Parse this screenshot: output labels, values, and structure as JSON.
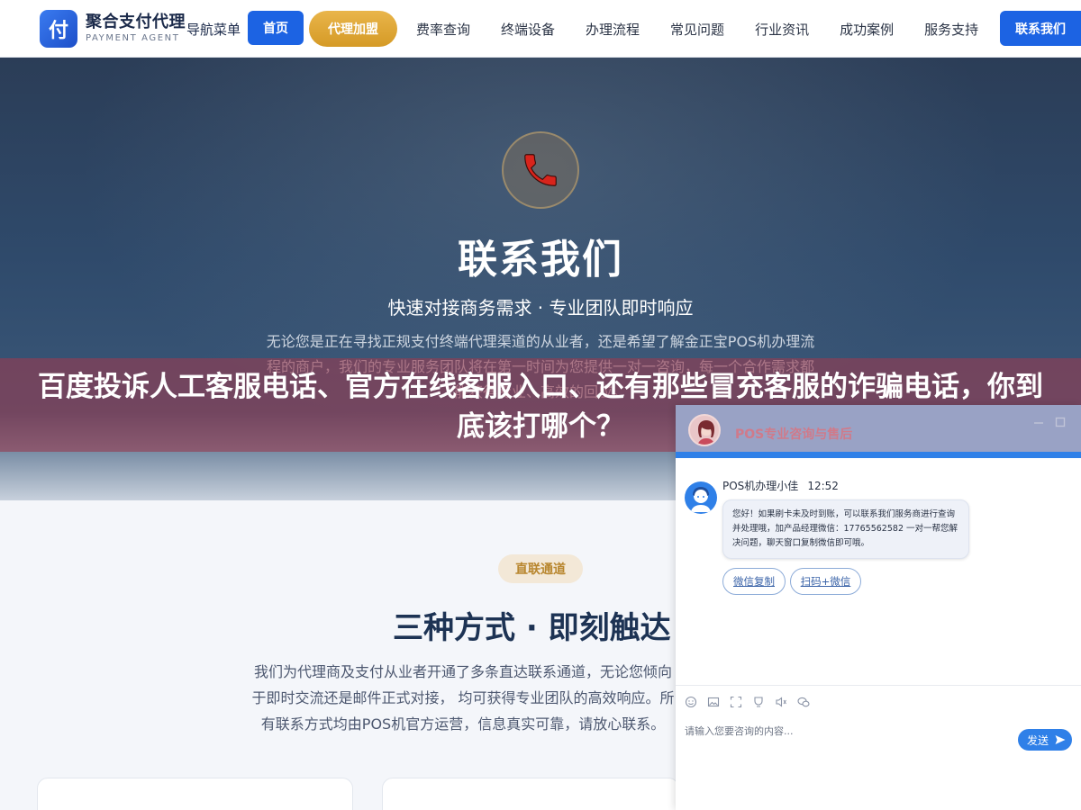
{
  "header": {
    "logo_mark": "付",
    "logo_cn": "聚合支付代理",
    "logo_en": "PAYMENT AGENT",
    "nav_label": "导航菜单",
    "home": "首页",
    "agent_join": "代理加盟",
    "links": [
      "费率查询",
      "终端设备",
      "办理流程",
      "常见问题",
      "行业资讯",
      "成功案例",
      "服务支持"
    ],
    "contact": "联系我们"
  },
  "hero": {
    "icon": "phone-icon",
    "title": "联系我们",
    "subtitle": "快速对接商务需求 · 专业团队即时响应",
    "description": "无论您是正在寻找正规支付终端代理渠道的从业者，还是希望了解金正宝POS机办理流程的商户，我们的专业服务团队将在第一时间为您提供一对一咨询，每一个合作需求都能获得专业、高效的回应。"
  },
  "banner": {
    "text": "百度投诉人工客服电话、官方在线客服入口、还有那些冒充客服的诈骗电话，你到底该打哪个？"
  },
  "section": {
    "pill": "直联通道",
    "title": "三种方式 · 即刻触达",
    "description": "我们为代理商及支付从业者开通了多条直达联系通道，无论您倾向于即时交流还是邮件正式对接， 均可获得专业团队的高效响应。所有联系方式均由POS机官方运营，信息真实可靠，请放心联系。"
  },
  "chat": {
    "title": "POS专业咨询与售后",
    "agent_name": "POS机办理小佳",
    "agent_time": "12:52",
    "message": "您好！如果刷卡未及时到账，可以联系我们服务商进行查询并处理哦，加产品经理微信：17765562582 一对一帮您解决问题，聊天窗口复制微信即可哦。",
    "quick_replies": [
      "微信复制",
      "扫码+微信"
    ],
    "toolbar_icons": [
      "emoji-icon",
      "image-icon",
      "screenshot-icon",
      "rating-icon",
      "voice-icon",
      "wechat-icon"
    ],
    "input_placeholder": "请输入您要咨询的内容...",
    "send": "发送"
  }
}
